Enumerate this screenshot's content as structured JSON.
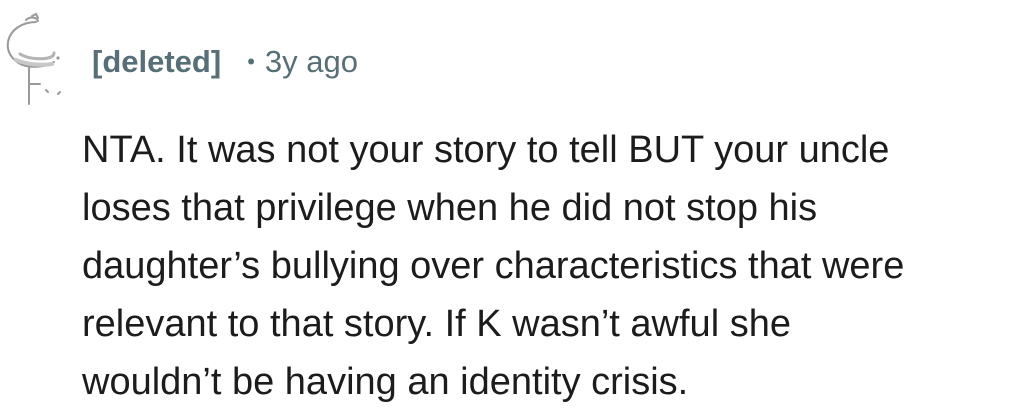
{
  "comment": {
    "author": "[deleted]",
    "separator": "•",
    "age": "3y ago",
    "avatar_icon": "snoo-avatar-icon",
    "body_lines": [
      "NTA. It was not your story to tell BUT your uncle",
      "loses that privilege when he did not stop his",
      "daughter’s bullying over characteristics that were",
      "relevant to that story. If K wasn’t awful she",
      "wouldn’t be having an identity crisis."
    ]
  },
  "colors": {
    "meta": "#576f76",
    "body": "#1c1c1c",
    "background": "#ffffff"
  }
}
